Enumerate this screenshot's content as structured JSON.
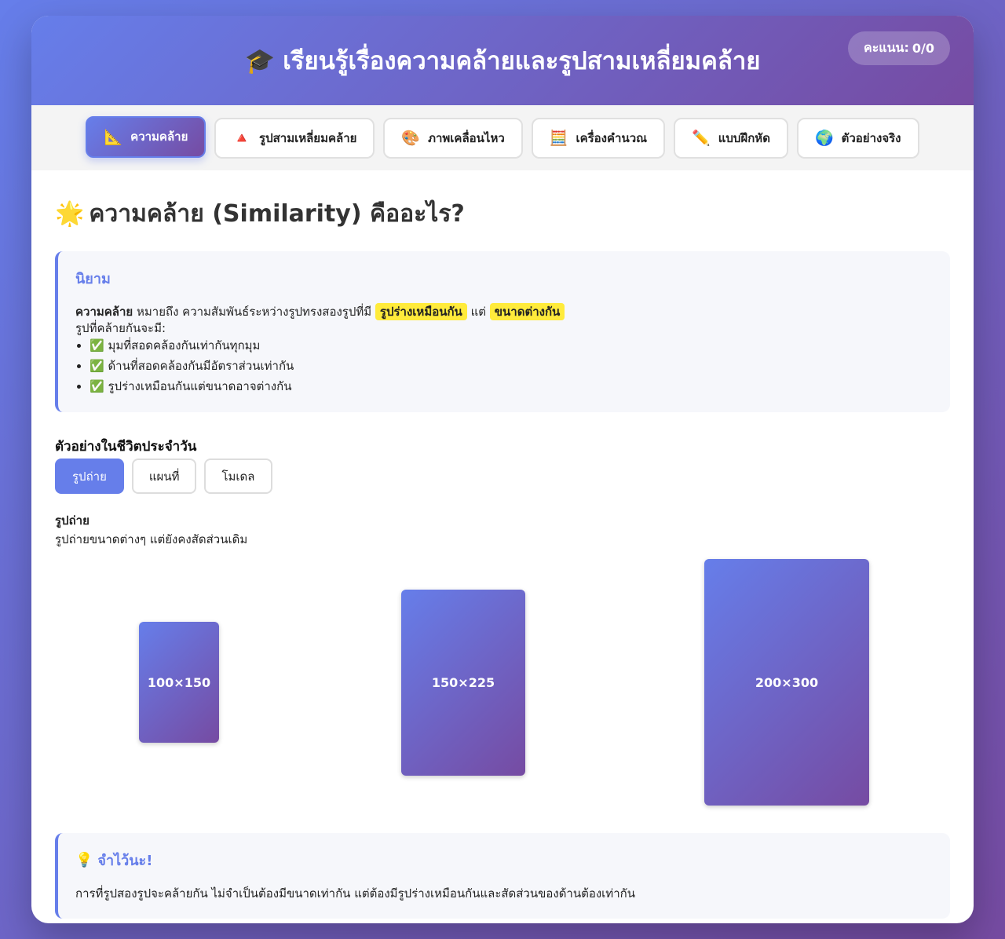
{
  "header": {
    "icon": "🎓",
    "title": "เรียนรู้เรื่องความคล้ายและรูปสามเหลี่ยมคล้าย",
    "score_label": "คะแนน:",
    "score_value": "0/0"
  },
  "tabs": [
    {
      "icon": "📐",
      "label": "ความคล้าย"
    },
    {
      "icon": "🔺",
      "label": "รูปสามเหลี่ยมคล้าย"
    },
    {
      "icon": "🎨",
      "label": "ภาพเคลื่อนไหว"
    },
    {
      "icon": "🧮",
      "label": "เครื่องคำนวณ"
    },
    {
      "icon": "✏️",
      "label": "แบบฝึกหัด"
    },
    {
      "icon": "🌍",
      "label": "ตัวอย่างจริง"
    }
  ],
  "section": {
    "icon": "🌟",
    "title": "ความคล้าย (Similarity) คืออะไร?"
  },
  "definition": {
    "title": "นิยาม",
    "term": "ความคล้าย",
    "text1": "หมายถึง ความสัมพันธ์ระหว่างรูปทรงสองรูปที่มี",
    "highlight1": "รูปร่างเหมือนกัน",
    "text2": "แต่",
    "highlight2": "ขนาดต่างกัน",
    "intro": "รูปที่คล้ายกันจะมี:",
    "items": [
      "✅ มุมที่สอดคล้องกันเท่ากันทุกมุม",
      "✅ ด้านที่สอดคล้องกันมีอัตราส่วนเท่ากัน",
      "✅ รูปร่างเหมือนกันแต่ขนาดอาจต่างกัน"
    ]
  },
  "examples": {
    "title": "ตัวอย่างในชีวิตประจำวัน",
    "tabs": [
      "รูปถ่าย",
      "แผนที่",
      "โมเดล"
    ],
    "active_name": "รูปถ่าย",
    "active_desc": "รูปถ่ายขนาดต่างๆ แต่ยังคงสัดส่วนเดิม",
    "rects": [
      {
        "label": "100×150"
      },
      {
        "label": "150×225"
      },
      {
        "label": "200×300"
      }
    ]
  },
  "tip": {
    "icon": "💡",
    "title": "จำไว้นะ!",
    "text": "การที่รูปสองรูปจะคล้ายกัน ไม่จำเป็นต้องมีขนาดเท่ากัน แต่ต้องมีรูปร่างเหมือนกันและสัดส่วนของด้านต้องเท่ากัน"
  }
}
